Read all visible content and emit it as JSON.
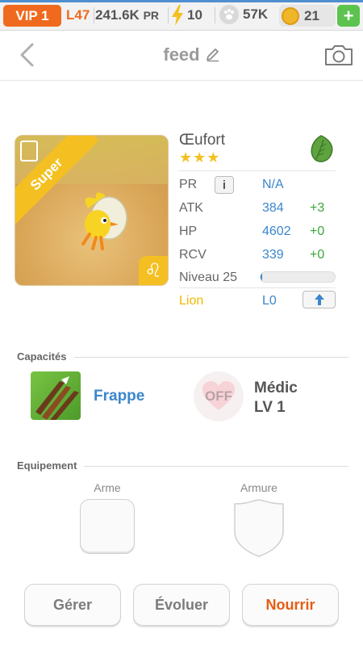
{
  "status_bar": {
    "vip": "VIP 1",
    "level": "L47",
    "power": "241.6K",
    "power_unit": "PR",
    "energy": "10",
    "pets": "57K",
    "coins": "21",
    "add_label": "+"
  },
  "header": {
    "title": "feed"
  },
  "monster": {
    "name": "Œufort",
    "stars": "★★★",
    "rank_ribbon": "Super",
    "zodiac_symbol": "♌",
    "element_icon": "leaf-icon",
    "element_color": "#5ea33f"
  },
  "stats": {
    "pr_label": "PR",
    "pr_value": "N/A",
    "info_label": "i",
    "rows": [
      {
        "label": "ATK",
        "value": "384",
        "bonus": "+3"
      },
      {
        "label": "HP",
        "value": "4602",
        "bonus": "+0"
      },
      {
        "label": "RCV",
        "value": "339",
        "bonus": "+0"
      }
    ],
    "level_label": "Niveau 25",
    "xp_fraction": 0.02,
    "sign_label": "Lion",
    "sign_level": "L0"
  },
  "skills": {
    "section_title": "Capacités",
    "active_name": "Frappe",
    "leader_state": "OFF",
    "leader_name": "Médic",
    "leader_level": "LV 1"
  },
  "equipment": {
    "section_title": "Equipement",
    "weapon_label": "Arme",
    "armor_label": "Armure"
  },
  "actions": {
    "manage": "Gérer",
    "evolve": "Évoluer",
    "feed": "Nourrir"
  },
  "colors": {
    "accent_orange": "#ef6a1f",
    "link_blue": "#3b86cc",
    "bonus_green": "#3aa83a",
    "ribbon_yellow": "#f4c021"
  }
}
